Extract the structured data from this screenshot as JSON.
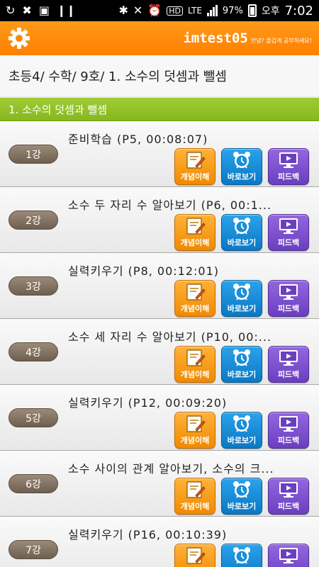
{
  "status_bar": {
    "battery": "97%",
    "network": "LTE",
    "ampm": "오후",
    "time": "7:02"
  },
  "header": {
    "user_id": "imtest05",
    "greeting": "안녕? 즐겁게 공부하세요!"
  },
  "breadcrumb": "초등4/ 수학/ 9호/ 1. 소수의 덧셈과 뺄셈",
  "section_title": "1. 소수의 덧셈과 뺄셈",
  "buttons": {
    "concept": "개념이해",
    "watch": "바로보기",
    "feedback": "피드백"
  },
  "lessons": [
    {
      "number": "1강",
      "title": "준비학습 (P5, 00:08:07)"
    },
    {
      "number": "2강",
      "title": "소수 두 자리 수 알아보기 (P6, 00:1..."
    },
    {
      "number": "3강",
      "title": "실력키우기 (P8, 00:12:01)"
    },
    {
      "number": "4강",
      "title": "소수 세 자리 수 알아보기 (P10, 00:..."
    },
    {
      "number": "5강",
      "title": "실력키우기 (P12, 00:09:20)"
    },
    {
      "number": "6강",
      "title": "소수 사이의 관계 알아보기, 소수의 크..."
    },
    {
      "number": "7강",
      "title": "실력키우기 (P16, 00:10:39)"
    }
  ],
  "colors": {
    "header_orange": "#ff8a00",
    "section_green": "#8fc028",
    "concept_orange": "#f59a10",
    "watch_blue": "#1a8ed8",
    "feedback_purple": "#7e52d0"
  }
}
